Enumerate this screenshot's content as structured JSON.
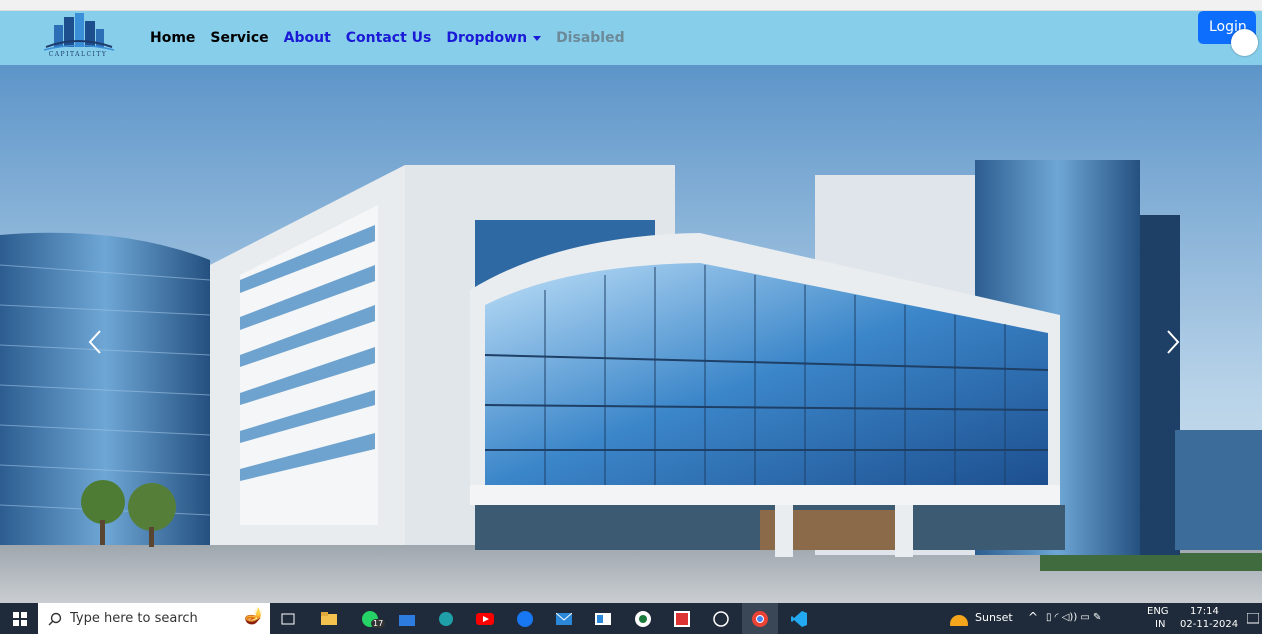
{
  "brand": {
    "logo_text": "CAPITALCITY"
  },
  "nav": {
    "links": [
      {
        "label": "Home",
        "color": "#000000"
      },
      {
        "label": "Service",
        "color": "#000000"
      },
      {
        "label": "About",
        "color": "#1a1ad6"
      },
      {
        "label": "Contact Us",
        "color": "#1a1ad6"
      },
      {
        "label": "Dropdown",
        "color": "#1a1ad6"
      },
      {
        "label": "Disabled",
        "color": "#6c8a98"
      }
    ],
    "login_label": "Login"
  },
  "carousel": {
    "prev_icon": "chevron-left-icon",
    "next_icon": "chevron-right-icon"
  },
  "taskbar": {
    "search_placeholder": "Type here to search",
    "whatsapp_badge": "17",
    "weather_label": "Sunset",
    "lang_top": "ENG",
    "lang_bottom": "IN",
    "time": "17:14",
    "date": "02-11-2024",
    "accent_colors": {
      "navbar": "#87ceeb",
      "login": "#0d6efd",
      "taskbar": "#1f2b3a"
    }
  }
}
